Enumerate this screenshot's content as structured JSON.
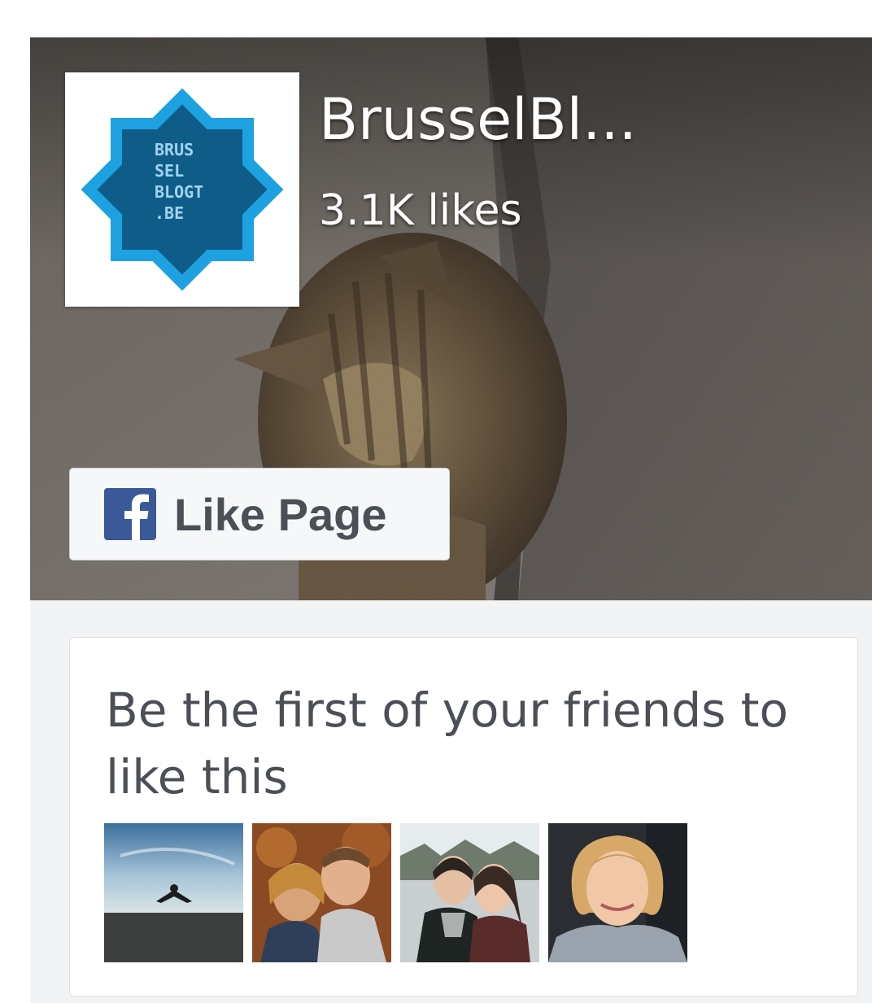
{
  "page": {
    "name": "BrusselBl...",
    "likes": "3.1K likes",
    "logo_lines": [
      "BRUS",
      "SEL",
      "BLOGT",
      ".BE"
    ]
  },
  "like_button": {
    "label": "Like Page",
    "icon": "facebook-f-icon"
  },
  "friends": {
    "message": "Be the first of your friends to like this",
    "photos": [
      {
        "name": "friend-photo-1"
      },
      {
        "name": "friend-photo-2"
      },
      {
        "name": "friend-photo-3"
      },
      {
        "name": "friend-photo-4"
      }
    ]
  },
  "colors": {
    "facebook_blue": "#3b5998",
    "logo_light_blue": "#1ea1e0",
    "logo_dark_blue": "#0f5c88",
    "text_dark": "#4b4f56",
    "panel_bg": "#f2f3f5"
  }
}
